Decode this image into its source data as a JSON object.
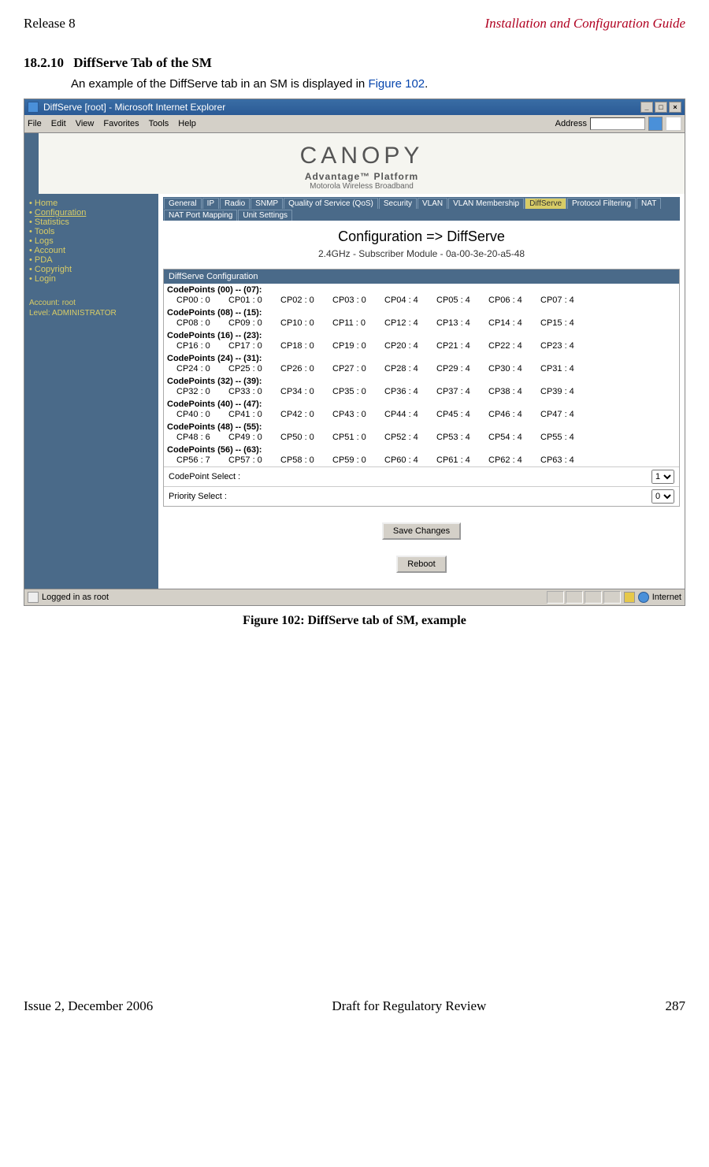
{
  "doc": {
    "release": "Release 8",
    "guide": "Installation and Configuration Guide",
    "section_num": "18.2.10",
    "section_title": "DiffServe Tab of the SM",
    "intro_pre": "An example of the DiffServe tab in an SM is displayed in ",
    "intro_link": "Figure 102",
    "intro_post": ".",
    "caption": "Figure 102: DiffServe tab of SM, example",
    "footer_issue": "Issue 2, December 2006",
    "footer_status": "Draft for Regulatory Review",
    "footer_page": "287"
  },
  "window": {
    "title": "DiffServe [root] - Microsoft Internet Explorer",
    "menus": [
      "File",
      "Edit",
      "View",
      "Favorites",
      "Tools",
      "Help"
    ],
    "address_label": "Address",
    "status_text": "Logged in as root",
    "status_zone": "Internet"
  },
  "brand": {
    "name": "CANOPY",
    "sub_bold": "Advantage™ Platform",
    "sub_small": "Motorola Wireless Broadband"
  },
  "tabs_top": [
    "General",
    "IP",
    "Radio",
    "SNMP",
    "Quality of Service (QoS)",
    "Security",
    "VLAN",
    "VLAN Membership",
    "DiffServe",
    "Protocol Filtering",
    "NAT",
    "NAT Port Mapping",
    "Unit Settings"
  ],
  "active_tab": "DiffServe",
  "sidebar": {
    "items": [
      "Home",
      "Configuration",
      "Statistics",
      "Tools",
      "Logs",
      "Account",
      "PDA",
      "Copyright",
      "Login"
    ],
    "selected": "Configuration",
    "account_line1": "Account: root",
    "account_line2": "Level: ADMINISTRATOR"
  },
  "page": {
    "title": "Configuration => DiffServe",
    "module": "2.4GHz - Subscriber Module - 0a-00-3e-20-a5-48",
    "box_title": "DiffServe Configuration",
    "codepoint_groups": [
      {
        "label": "CodePoints (00) -- (07):",
        "vals": [
          "CP00 : 0",
          "CP01 : 0",
          "CP02 : 0",
          "CP03 : 0",
          "CP04 : 4",
          "CP05 : 4",
          "CP06 : 4",
          "CP07 : 4"
        ]
      },
      {
        "label": "CodePoints (08) -- (15):",
        "vals": [
          "CP08 : 0",
          "CP09 : 0",
          "CP10 : 0",
          "CP11 : 0",
          "CP12 : 4",
          "CP13 : 4",
          "CP14 : 4",
          "CP15 : 4"
        ]
      },
      {
        "label": "CodePoints (16) -- (23):",
        "vals": [
          "CP16 : 0",
          "CP17 : 0",
          "CP18 : 0",
          "CP19 : 0",
          "CP20 : 4",
          "CP21 : 4",
          "CP22 : 4",
          "CP23 : 4"
        ]
      },
      {
        "label": "CodePoints (24) -- (31):",
        "vals": [
          "CP24 : 0",
          "CP25 : 0",
          "CP26 : 0",
          "CP27 : 0",
          "CP28 : 4",
          "CP29 : 4",
          "CP30 : 4",
          "CP31 : 4"
        ]
      },
      {
        "label": "CodePoints (32) -- (39):",
        "vals": [
          "CP32 : 0",
          "CP33 : 0",
          "CP34 : 0",
          "CP35 : 0",
          "CP36 : 4",
          "CP37 : 4",
          "CP38 : 4",
          "CP39 : 4"
        ]
      },
      {
        "label": "CodePoints (40) -- (47):",
        "vals": [
          "CP40 : 0",
          "CP41 : 0",
          "CP42 : 0",
          "CP43 : 0",
          "CP44 : 4",
          "CP45 : 4",
          "CP46 : 4",
          "CP47 : 4"
        ]
      },
      {
        "label": "CodePoints (48) -- (55):",
        "vals": [
          "CP48 : 6",
          "CP49 : 0",
          "CP50 : 0",
          "CP51 : 0",
          "CP52 : 4",
          "CP53 : 4",
          "CP54 : 4",
          "CP55 : 4"
        ]
      },
      {
        "label": "CodePoints (56) -- (63):",
        "vals": [
          "CP56 : 7",
          "CP57 : 0",
          "CP58 : 0",
          "CP59 : 0",
          "CP60 : 4",
          "CP61 : 4",
          "CP62 : 4",
          "CP63 : 4"
        ]
      }
    ],
    "codepoint_select_label": "CodePoint Select :",
    "codepoint_select_value": "1",
    "priority_select_label": "Priority Select :",
    "priority_select_value": "0",
    "save_button": "Save Changes",
    "reboot_button": "Reboot"
  }
}
